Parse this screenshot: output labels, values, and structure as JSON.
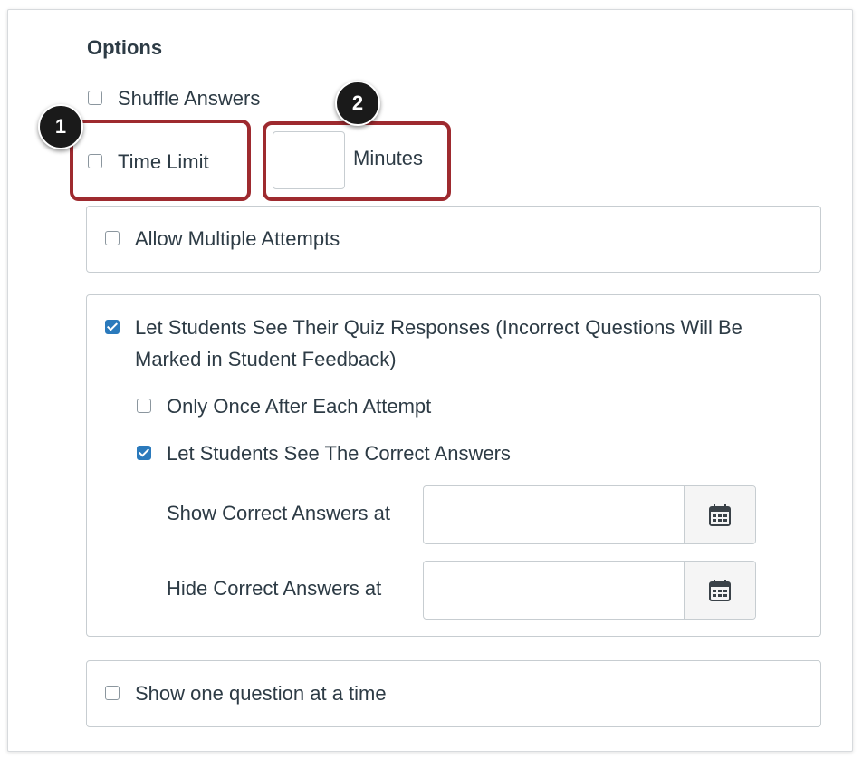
{
  "options": {
    "heading": "Options",
    "shuffle_answers": {
      "label": "Shuffle Answers",
      "checked": false
    },
    "time_limit": {
      "label": "Time Limit",
      "checked": false,
      "minutes_value": "",
      "minutes_unit": "Minutes"
    },
    "allow_multiple_attempts": {
      "label": "Allow Multiple Attempts",
      "checked": false
    },
    "see_responses": {
      "label_line1": "Let Students See Their Quiz Responses (Incorrect Questions Will Be",
      "label_line2": "Marked in Student Feedback)",
      "checked": true,
      "only_once": {
        "label": "Only Once After Each Attempt",
        "checked": false
      },
      "see_correct": {
        "label": "Let Students See The Correct Answers",
        "checked": true
      },
      "show_correct_at": {
        "label": "Show Correct Answers at",
        "value": ""
      },
      "hide_correct_at": {
        "label": "Hide Correct Answers at",
        "value": ""
      }
    },
    "one_question": {
      "label": "Show one question at a time",
      "checked": false
    }
  },
  "callouts": {
    "one": "1",
    "two": "2"
  },
  "colors": {
    "highlight": "#9e2a2f",
    "checkbox_checked": "#2b7abc",
    "badge": "#1a1a1a"
  },
  "icons": {
    "calendar": "calendar-icon"
  }
}
